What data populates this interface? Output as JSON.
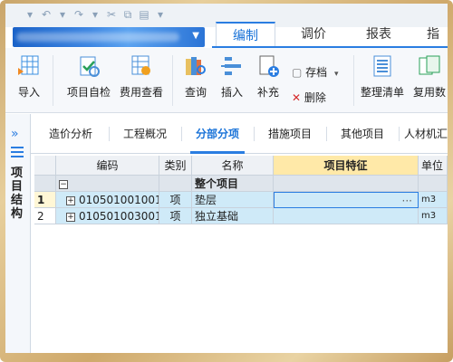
{
  "ribbon_tabs": [
    "编制",
    "调价",
    "报表",
    "指"
  ],
  "active_ribbon_tab": "编制",
  "toolbar": {
    "import": "导入",
    "self_check": "项目自检",
    "fee_view": "费用查看",
    "query": "查询",
    "insert": "插入",
    "supplement": "补充",
    "archive": "存档",
    "delete": "删除",
    "organize_list": "整理清单",
    "reuse": "复用数"
  },
  "left_panel": {
    "title": "项目结构"
  },
  "sub_tabs": [
    "造价分析",
    "工程概况",
    "分部分项",
    "措施项目",
    "其他项目",
    "人材机汇"
  ],
  "active_sub_tab": "分部分项",
  "table": {
    "headers": [
      "编码",
      "类别",
      "名称",
      "项目特征",
      "单位"
    ],
    "group_row": {
      "name": "整个项目"
    },
    "rows": [
      {
        "index": "1",
        "code": "010501001001",
        "type": "项",
        "name": "垫层",
        "feature": "",
        "unit": "m3"
      },
      {
        "index": "2",
        "code": "010501003001",
        "type": "项",
        "name": "独立基础",
        "feature": "",
        "unit": "m3"
      }
    ]
  },
  "colors": {
    "accent": "#2a7de1",
    "highlight_header": "#ffe9a8",
    "selected_row": "#cfeaf8"
  }
}
